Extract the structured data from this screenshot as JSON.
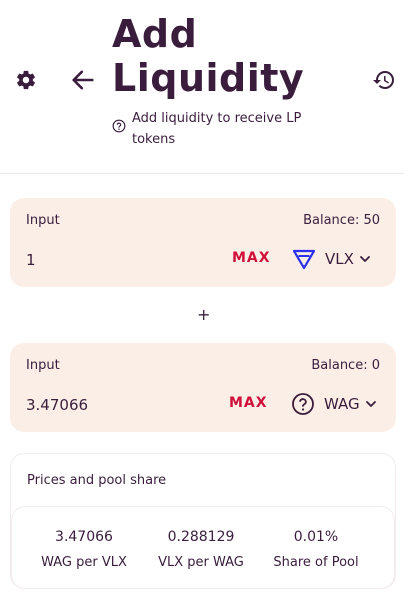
{
  "header": {
    "title": "Add Liquidity",
    "help_text": "Add liquidity to receive LP tokens",
    "icons": {
      "settings": "gear-icon",
      "back": "arrow-left-icon",
      "history": "history-icon",
      "help": "question-circle-icon"
    }
  },
  "input_a": {
    "label": "Input",
    "balance": "Balance: 50",
    "amount": "1",
    "max_label": "MAX",
    "token": "VLX",
    "token_icon": "velas-logo-icon"
  },
  "plus": "+",
  "input_b": {
    "label": "Input",
    "balance": "Balance: 0",
    "amount": "3.47066",
    "max_label": "MAX",
    "token": "WAG",
    "token_icon": "question-circle-icon"
  },
  "pool": {
    "title": "Prices and pool share",
    "stats": [
      {
        "value": "3.47066",
        "label": "WAG per VLX"
      },
      {
        "value": "0.288129",
        "label": "VLX per WAG"
      },
      {
        "value": "0.01%",
        "label": "Share of Pool"
      }
    ]
  },
  "colors": {
    "text": "#3a1d3d",
    "card_bg": "#fbeee6",
    "max": "#d0103a",
    "velas": "#2a2ff0"
  }
}
